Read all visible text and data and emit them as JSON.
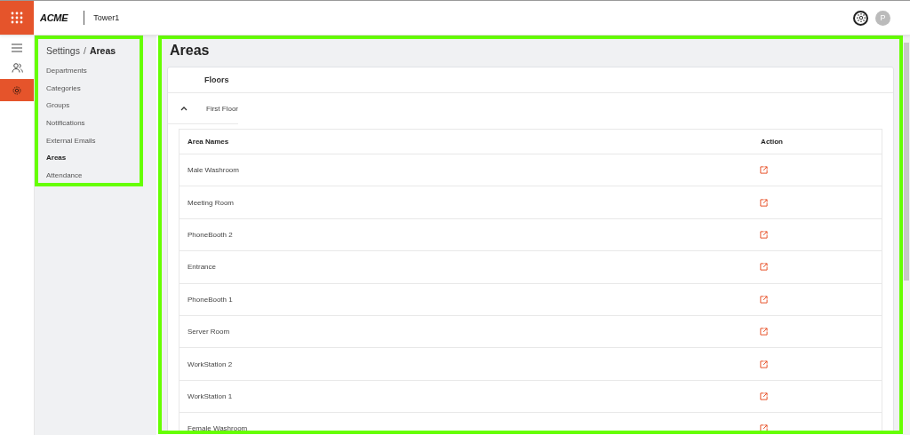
{
  "header": {
    "logo": "ACME",
    "site": "Tower1",
    "avatar": "P"
  },
  "rail": [
    {
      "kind": "menu",
      "selected": false
    },
    {
      "kind": "users",
      "selected": false
    },
    {
      "kind": "settings",
      "selected": true
    }
  ],
  "breadcrumb": {
    "parent": "Settings",
    "separator": "/",
    "current": "Areas"
  },
  "settings_menu": [
    {
      "label": "Departments",
      "selected": false
    },
    {
      "label": "Categories",
      "selected": false
    },
    {
      "label": "Groups",
      "selected": false
    },
    {
      "label": "Notifications",
      "selected": false
    },
    {
      "label": "External Emails",
      "selected": false
    },
    {
      "label": "Areas",
      "selected": true
    },
    {
      "label": "Attendance",
      "selected": false
    }
  ],
  "page_title": "Areas",
  "floors_heading": "Floors",
  "floor": {
    "name": "First Floor",
    "expanded": true
  },
  "table": {
    "columns": [
      "Area Names",
      "Action"
    ],
    "rows": [
      "Male Washroom",
      "Meeting Room",
      "PhoneBooth 2",
      "Entrance",
      "PhoneBooth 1",
      "Server Room",
      "WorkStation 2",
      "WorkStation 1",
      "Female Washroom"
    ]
  }
}
